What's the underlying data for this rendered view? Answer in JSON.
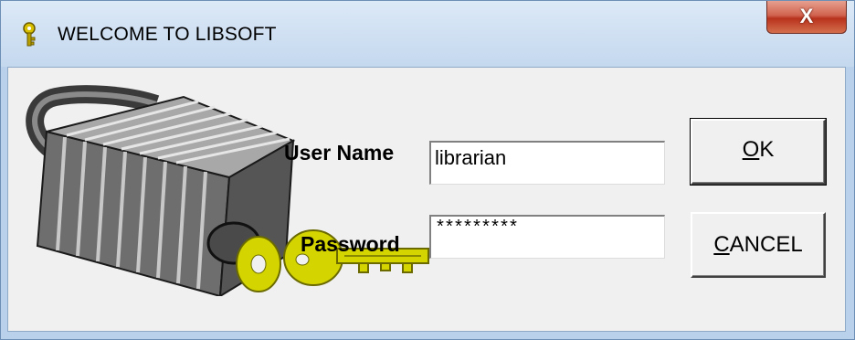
{
  "window": {
    "title": "WELCOME TO LIBSOFT",
    "close_label": "X"
  },
  "form": {
    "username_label": "User Name",
    "username_value": "librarian",
    "password_label": "Password",
    "password_value": "*********"
  },
  "buttons": {
    "ok_mnemonic": "O",
    "ok_rest": "K",
    "cancel_mnemonic": "C",
    "cancel_rest": "ANCEL"
  },
  "icons": {
    "title": "key-icon",
    "graphic": "padlock-with-keys-icon"
  },
  "colors": {
    "title_bar": "#c4d8ee",
    "close_button": "#c74a33",
    "client_bg": "#f0f0f0",
    "key_gold": "#d4d400"
  }
}
